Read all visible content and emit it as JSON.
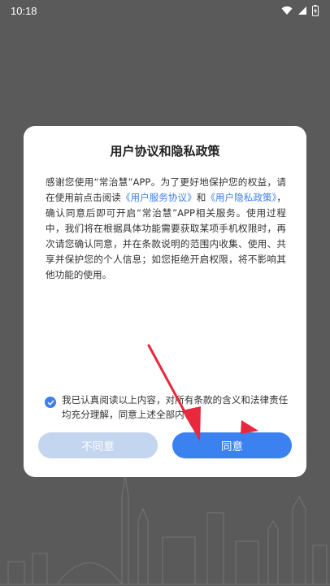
{
  "status_bar": {
    "time": "10:18"
  },
  "dialog": {
    "title": "用户协议和隐私政策",
    "body": {
      "p1": "感谢您使用“常治慧”APP。为了更好地保护您的权益，请在使用前点击阅读",
      "link1": "《用户服务协议》",
      "and": "和",
      "link2": "《用户隐私政策》",
      "p2": "，确认同意后即可开启“常治慧”APP相关服务。使用过程中，我们将在根据具体功能需要获取某项手机权限时，再次请您确认同意，并在条款说明的范围内收集、使用、共享并保护您的个人信息；如您拒绝开启权限，将不影响其他功能的使用。"
    },
    "consent_text": "我已认真阅读以上内容，对所有条款的含义和法律责任均充分理解，同意上述全部内容。",
    "consent_checked": true,
    "disagree_label": "不同意",
    "agree_label": "同意"
  },
  "colors": {
    "accent": "#3b82f0",
    "link": "#3d7fe6",
    "disabled_button": "#c3d5ef",
    "backdrop": "#5a5a5a",
    "annotation_arrow": "#e8283c"
  }
}
